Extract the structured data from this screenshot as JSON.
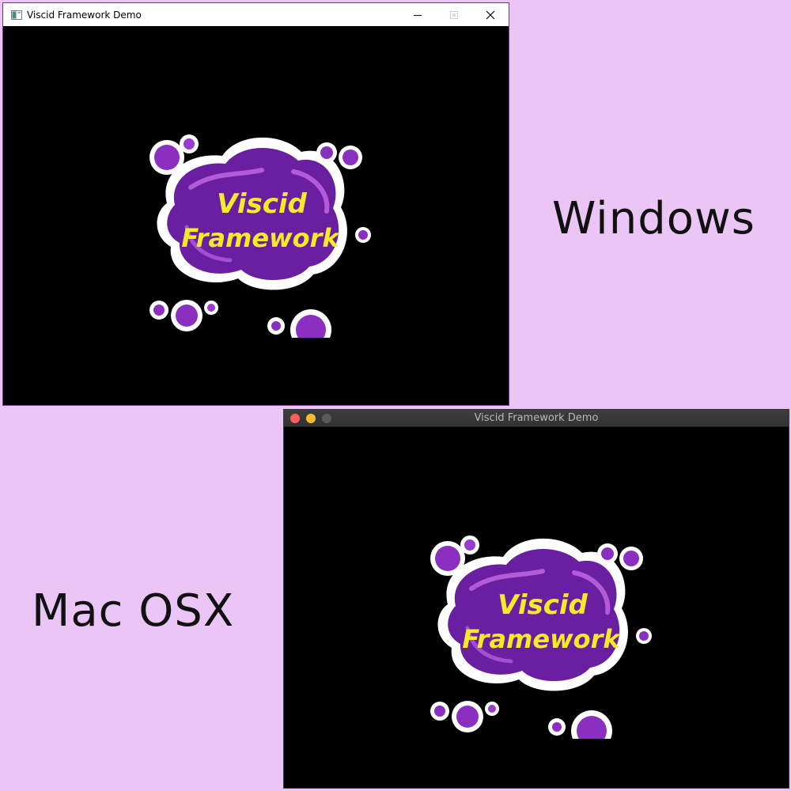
{
  "windows_window": {
    "title": "Viscid Framework Demo",
    "logo": {
      "line1": "Viscid",
      "line2": "Framework"
    }
  },
  "mac_window": {
    "title": "Viscid Framework Demo",
    "logo": {
      "line1": "Viscid",
      "line2": "Framework"
    }
  },
  "captions": {
    "windows": "Windows",
    "mac": "Mac OSX"
  },
  "icons": {
    "app": "app-window-icon",
    "minimize": "minimize-icon",
    "maximize": "maximize-icon",
    "close": "close-icon"
  },
  "colors": {
    "background": "#ecc5f7",
    "logo_purple": "#6a1fa0",
    "logo_text": "#f5ea2a",
    "mac_close": "#fc5f57",
    "mac_min": "#fdbc2e"
  }
}
